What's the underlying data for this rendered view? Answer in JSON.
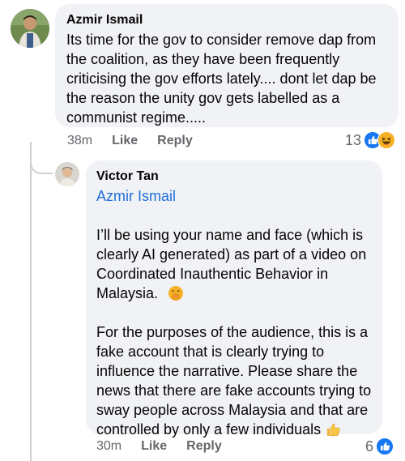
{
  "comment": {
    "author": "Azmir Ismail",
    "text": "Its time for the gov to consider remove dap from the coalition, as they have been frequently criticising the gov efforts lately.... dont let dap be the reason the unity gov gets labelled as a communist regime.....",
    "time": "38m",
    "like_label": "Like",
    "reply_label": "Reply",
    "reaction_count": "13",
    "reactions": [
      "like-icon",
      "laugh-icon"
    ]
  },
  "reply": {
    "author": "Victor Tan",
    "mention": "Azmir Ismail",
    "para1": "I’ll be using your name and face (which is clearly AI generated) as part of a video on Coordinated Inauthentic Behavior in Malaysia.",
    "para2": "For the purposes of the audience, this is a fake account that is clearly trying to influence the narrative. Please share the news that there are fake accounts trying to sway people across Malaysia and that are controlled by only a few individuals",
    "emoji1": "hand-over-mouth-emoji",
    "emoji2": "thumbs-up-emoji",
    "time": "30m",
    "like_label": "Like",
    "reply_label": "Reply",
    "reaction_count": "6",
    "reactions": [
      "like-icon"
    ]
  },
  "colors": {
    "bubble": "#f0f2f5",
    "meta": "#65676b",
    "mention": "#216fdb",
    "like_blue": "#1877f2"
  }
}
